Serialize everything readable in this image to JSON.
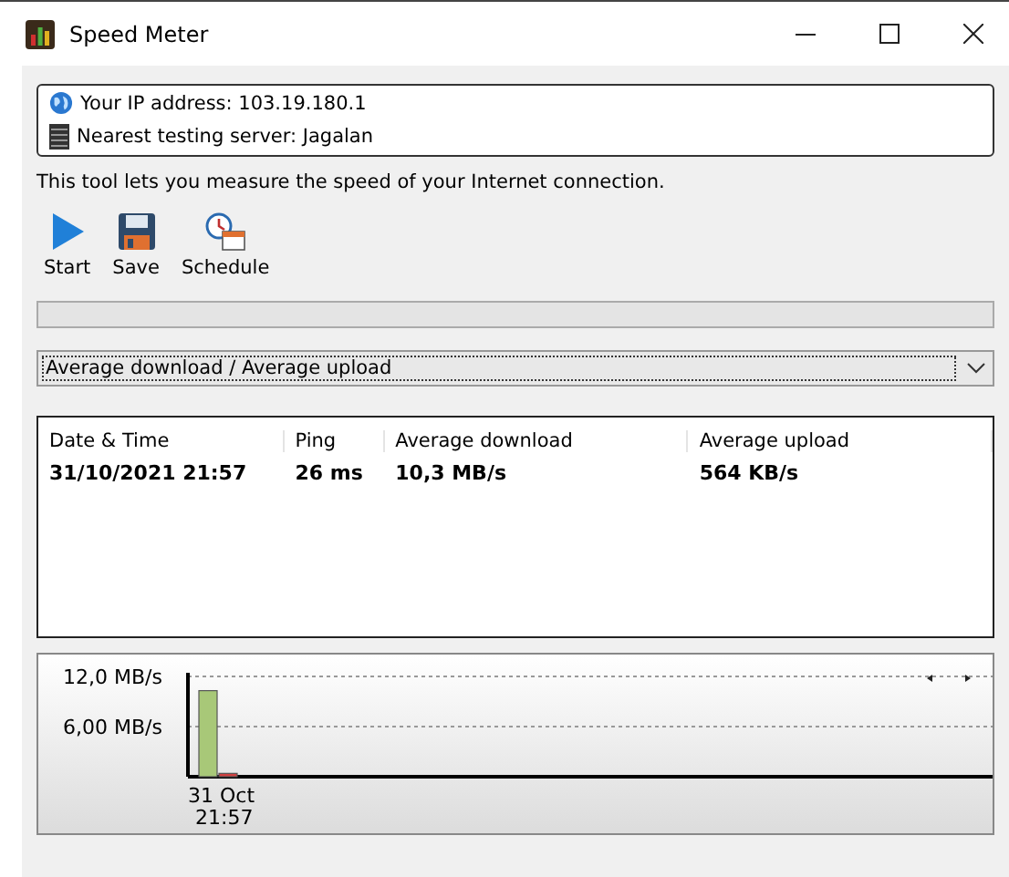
{
  "window": {
    "title": "Speed Meter"
  },
  "info": {
    "ip": "Your IP address: 103.19.180.1",
    "server": "Nearest testing server: Jagalan"
  },
  "description": "This tool lets you measure the speed of your Internet connection.",
  "toolbar": [
    {
      "label": "Start",
      "kind": "start"
    },
    {
      "label": "Save",
      "kind": "save"
    },
    {
      "label": "Schedule",
      "kind": "schedule"
    }
  ],
  "dropdown": {
    "value": "Average download / Average upload"
  },
  "table": {
    "columns": [
      "Date & Time",
      "Ping",
      "Average download",
      "Average upload"
    ],
    "rows": [
      [
        "31/10/2021 21:57",
        "26 ms",
        "10,3 MB/s",
        "564 KB/s"
      ]
    ]
  },
  "chart_data": {
    "type": "bar",
    "categories": [
      "31 Oct 21:57"
    ],
    "series": [
      {
        "color": "#a8c878",
        "values": [
          10.3
        ]
      },
      {
        "color": "#d04040",
        "values": [
          0.4
        ]
      }
    ],
    "ylim": [
      0,
      12
    ],
    "yticks": [
      {
        "value": 6,
        "label": "6,00 MB/s"
      },
      {
        "value": 12,
        "label": "12,0 MB/s"
      }
    ]
  }
}
